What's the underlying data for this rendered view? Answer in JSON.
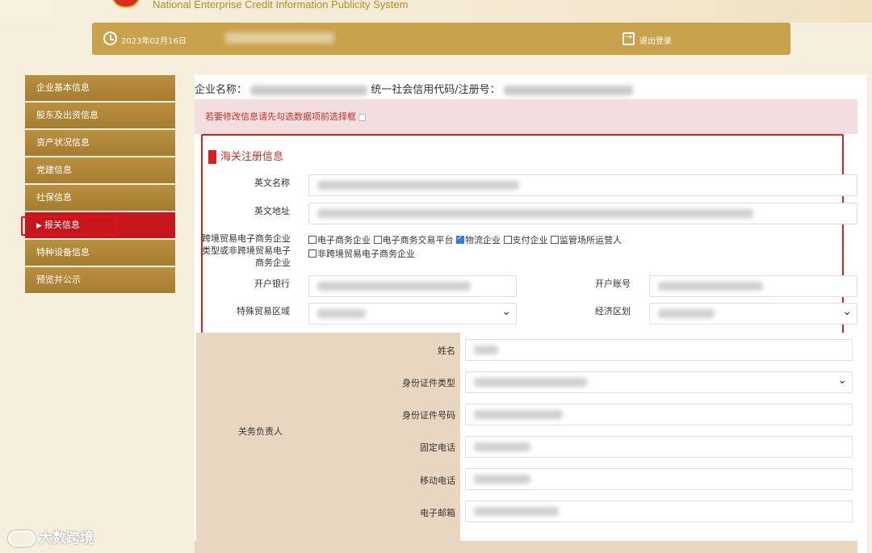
{
  "header": {
    "system_title": "National Enterprise Credit Information Publicity System",
    "date": "2023年02月16日",
    "logout": "退出登录"
  },
  "sidebar": {
    "items": [
      {
        "label": "企业基本信息"
      },
      {
        "label": "股东及出资信息"
      },
      {
        "label": "资产状况信息"
      },
      {
        "label": "党建信息"
      },
      {
        "label": "社保信息"
      },
      {
        "label": "报关信息"
      },
      {
        "label": "特种设备信息"
      },
      {
        "label": "预览并公示"
      }
    ],
    "active_index": 5
  },
  "main": {
    "company_label": "企业名称：",
    "credit_label": "统一社会信用代码/注册号：",
    "notice": "若要修改信息请先勾选数据项前选择框",
    "section_title": "海关注册信息",
    "fields": {
      "english_name": "英文名称",
      "english_address": "英文地址",
      "ecommerce_type": "跨境贸易电子商务企业类型或非跨境贸易电子商务企业",
      "bank": "开户银行",
      "account": "开户账号",
      "special_zone": "特殊贸易区域",
      "economic_zone": "经济区划"
    },
    "ecommerce_options": [
      {
        "label": "电子商务企业",
        "checked": false
      },
      {
        "label": "电子商务交易平台",
        "checked": false
      },
      {
        "label": "物流企业",
        "checked": true
      },
      {
        "label": "支付企业",
        "checked": false
      },
      {
        "label": "监管场所运营人",
        "checked": false
      },
      {
        "label": "非跨境贸易电子商务企业",
        "checked": false
      }
    ],
    "contact": {
      "role": "关务负责人",
      "labels": {
        "name": "姓名",
        "id_type": "身份证件类型",
        "id_number": "身份证件号码",
        "phone": "固定电话",
        "mobile": "移动电话",
        "email": "电子邮箱"
      }
    }
  },
  "watermark": "大数跨境",
  "colors": {
    "gold": "#c9a24d",
    "active_red": "#c4161c",
    "frame_red": "#d32420"
  }
}
